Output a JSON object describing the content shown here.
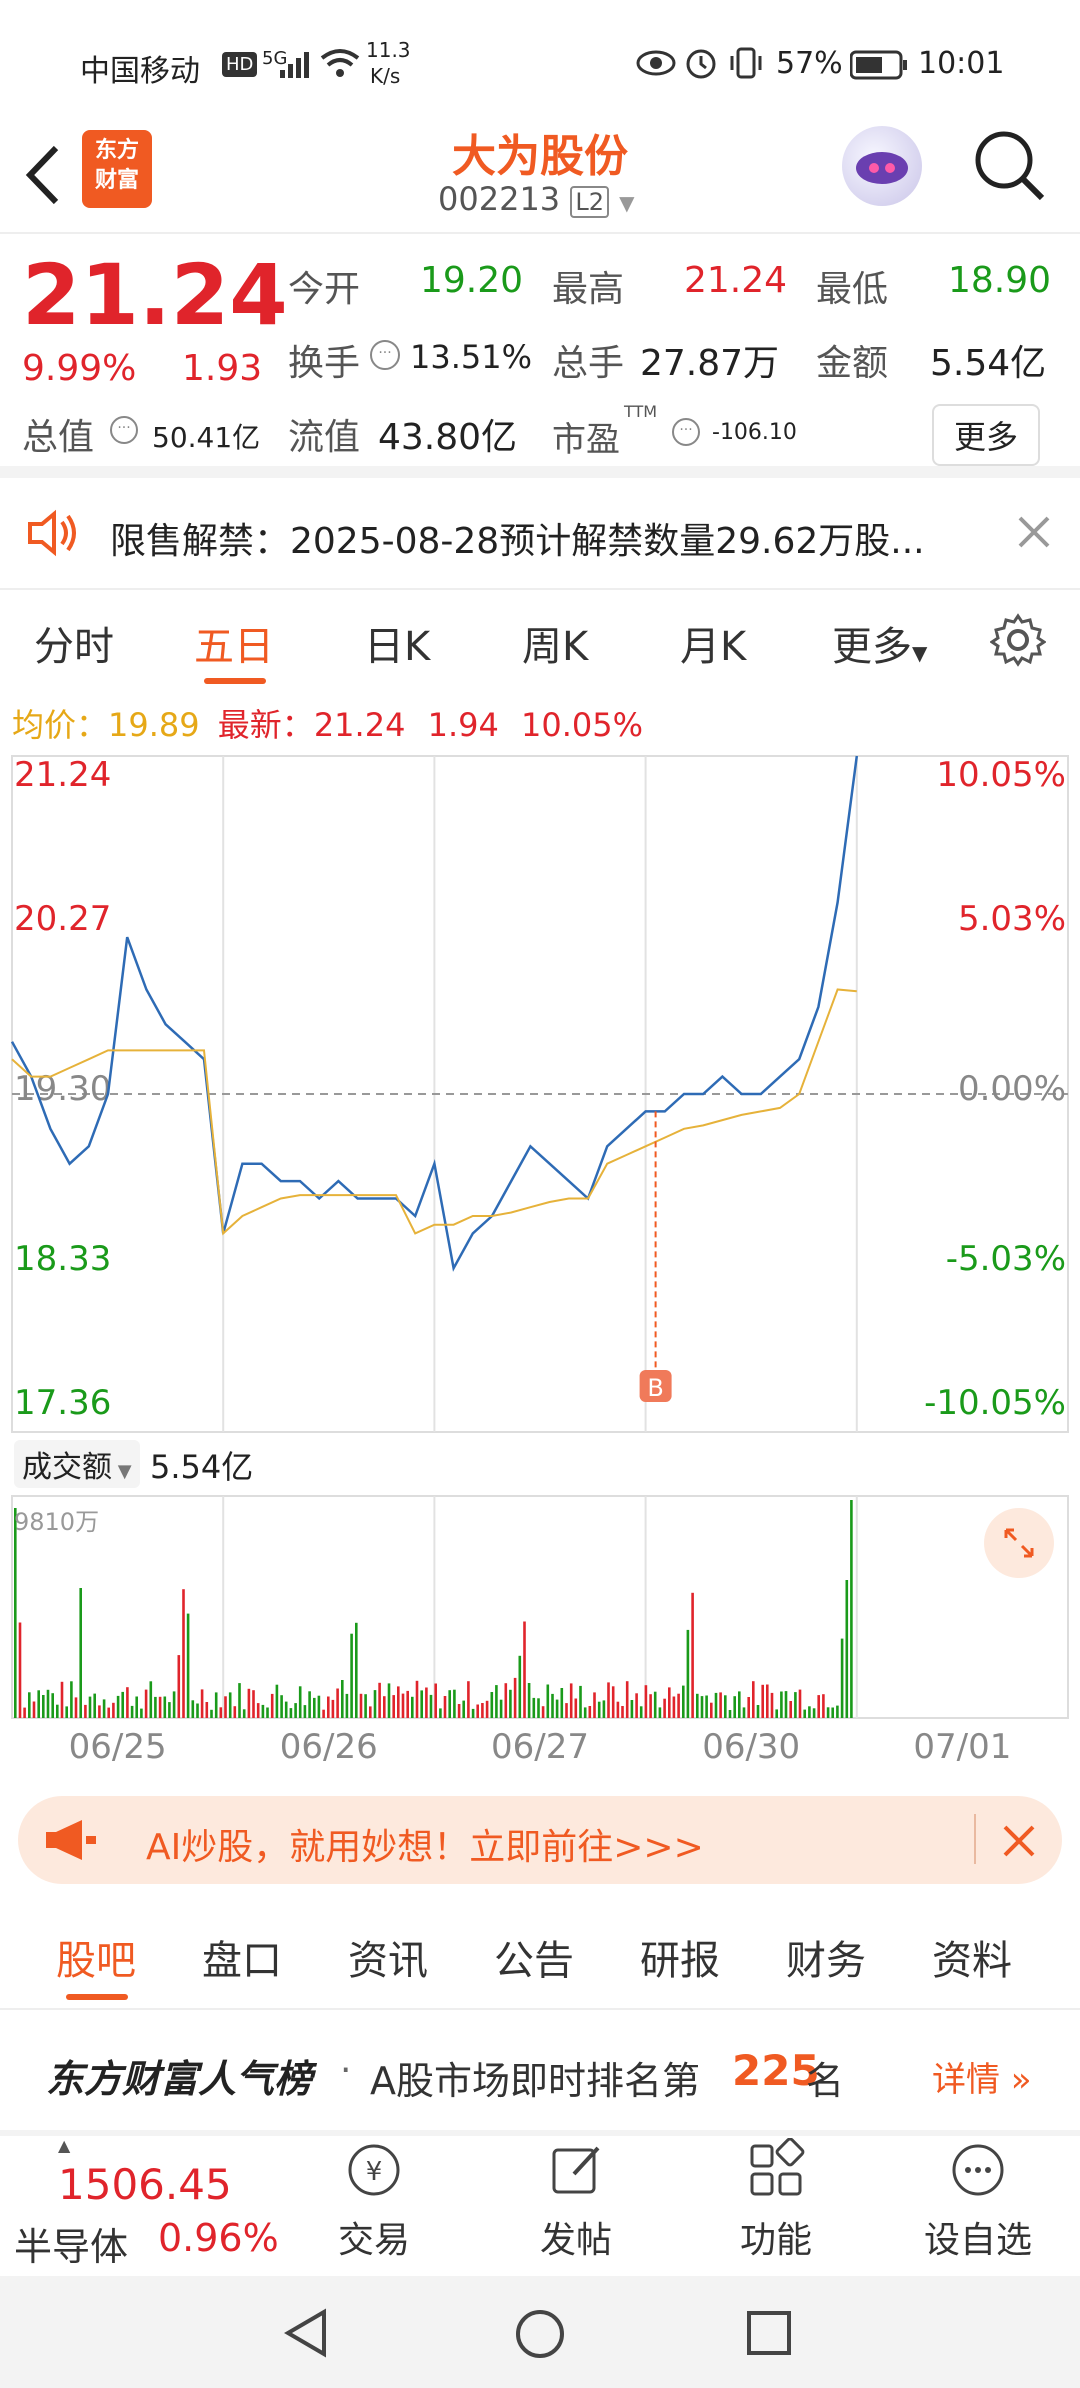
{
  "status": {
    "carrier": "中国移动",
    "hd": "HD",
    "net": "5G",
    "speed_value": "11.3",
    "speed_unit": "K/s",
    "battery": "57%",
    "time": "10:01"
  },
  "header": {
    "logo_text_1": "东方",
    "logo_text_2": "财富",
    "title": "大为股份",
    "code": "002213",
    "level": "L2"
  },
  "quote": {
    "price": "21.24",
    "change_pct": "9.99%",
    "change": "1.93",
    "open_label": "今开",
    "open": "19.20",
    "high_label": "最高",
    "high": "21.24",
    "low_label": "最低",
    "low": "18.90",
    "turnover_label": "换手",
    "turnover": "13.51%",
    "volume_label": "总手",
    "volume": "27.87万",
    "amount_label": "金额",
    "amount": "5.54亿",
    "mktcap_label": "总值",
    "mktcap": "50.41亿",
    "float_label": "流值",
    "float": "43.80亿",
    "pe_label": "市盈",
    "pe_sup": "TTM",
    "pe": "-106.10",
    "more": "更多"
  },
  "notice": {
    "text": "限售解禁：2025-08-28预计解禁数量29.62万股..."
  },
  "tabs": [
    "分时",
    "五日",
    "日K",
    "周K",
    "月K",
    "更多"
  ],
  "infoline": {
    "avg_label": "均价：",
    "avg": "19.89",
    "latest_label": "最新：",
    "latest": "21.24",
    "chg": "1.94",
    "pct": "10.05%"
  },
  "chart_data": {
    "type": "line",
    "title": "",
    "y_left_ticks": [
      "21.24",
      "20.27",
      "19.30",
      "18.33",
      "17.36"
    ],
    "y_right_ticks": [
      "10.05%",
      "5.03%",
      "0.00%",
      "-5.03%",
      "-10.05%"
    ],
    "ylim": [
      17.36,
      21.24
    ],
    "x_ticks": [
      "06/25",
      "06/26",
      "06/27",
      "06/30",
      "07/01"
    ],
    "series": [
      {
        "name": "",
        "color": "#2e6bb5",
        "values": [
          19.6,
          19.4,
          19.1,
          18.9,
          19.0,
          19.3,
          20.2,
          19.9,
          19.7,
          19.6,
          19.5,
          18.5,
          18.9,
          18.9,
          18.8,
          18.8,
          18.7,
          18.8,
          18.7,
          18.7,
          18.7,
          18.6,
          18.9,
          18.3,
          18.5,
          18.6,
          18.8,
          19.0,
          18.9,
          18.8,
          18.7,
          19.0,
          19.1,
          19.2,
          19.2,
          19.3,
          19.3,
          19.4,
          19.3,
          19.3,
          19.4,
          19.5,
          19.8,
          20.4,
          21.24
        ]
      },
      {
        "name": "",
        "color": "#e6b23a",
        "values": [
          19.5,
          19.4,
          19.4,
          19.45,
          19.5,
          19.55,
          19.55,
          19.55,
          19.55,
          19.55,
          19.55,
          18.5,
          18.6,
          18.65,
          18.7,
          18.72,
          18.72,
          18.72,
          18.72,
          18.72,
          18.72,
          18.5,
          18.55,
          18.55,
          18.6,
          18.6,
          18.62,
          18.65,
          18.68,
          18.7,
          18.7,
          18.9,
          18.95,
          19.0,
          19.05,
          19.1,
          19.12,
          19.15,
          19.18,
          19.2,
          19.22,
          19.3,
          19.6,
          19.9,
          19.89
        ]
      }
    ],
    "marker": "B",
    "volume_label": "成交额",
    "volume_total": "5.54亿",
    "volume_max_label": "9810万"
  },
  "ad": {
    "text": "AI炒股，就用妙想！立即前往>>>"
  },
  "subtabs": [
    "股吧",
    "盘口",
    "资讯",
    "公告",
    "研报",
    "财务",
    "资料"
  ],
  "rank": {
    "brand": "东方财富人气榜",
    "sep": " · ",
    "text": "A股市场即时排名第",
    "num": "225",
    "suffix": "名",
    "detail": "详情"
  },
  "bottomnav": {
    "index_value": "1506.45",
    "index_name": "半导体",
    "index_pct": "0.96%",
    "items": [
      "交易",
      "发帖",
      "功能",
      "设自选"
    ]
  }
}
